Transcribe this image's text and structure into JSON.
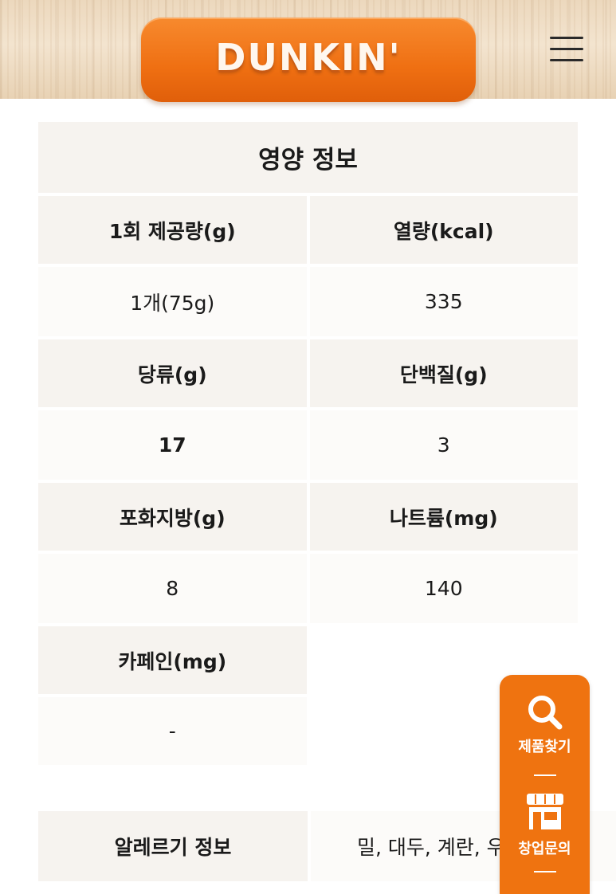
{
  "header": {
    "logo_text": "DUNKIN'",
    "menu_icon": "hamburger-menu-icon",
    "brand_color": "#ef7310"
  },
  "nutrition": {
    "title": "영양 정보",
    "rows": [
      {
        "left_label": "1회 제공량(g)",
        "left_value": "1개(75g)",
        "right_label": "열량(kcal)",
        "right_value": "335"
      },
      {
        "left_label": "당류(g)",
        "left_value": "17",
        "right_label": "단백질(g)",
        "right_value": "3"
      },
      {
        "left_label": "포화지방(g)",
        "left_value": "8",
        "right_label": "나트륨(mg)",
        "right_value": "140"
      },
      {
        "left_label": "카페인(mg)",
        "left_value": "-"
      }
    ]
  },
  "allergy": {
    "label": "알레르기 정보",
    "value": "밀, 대두, 계란, 우유"
  },
  "floating_menu": {
    "items": [
      {
        "label": "제품찾기",
        "icon": "search-icon"
      },
      {
        "label": "창업문의",
        "icon": "store-icon"
      }
    ]
  }
}
